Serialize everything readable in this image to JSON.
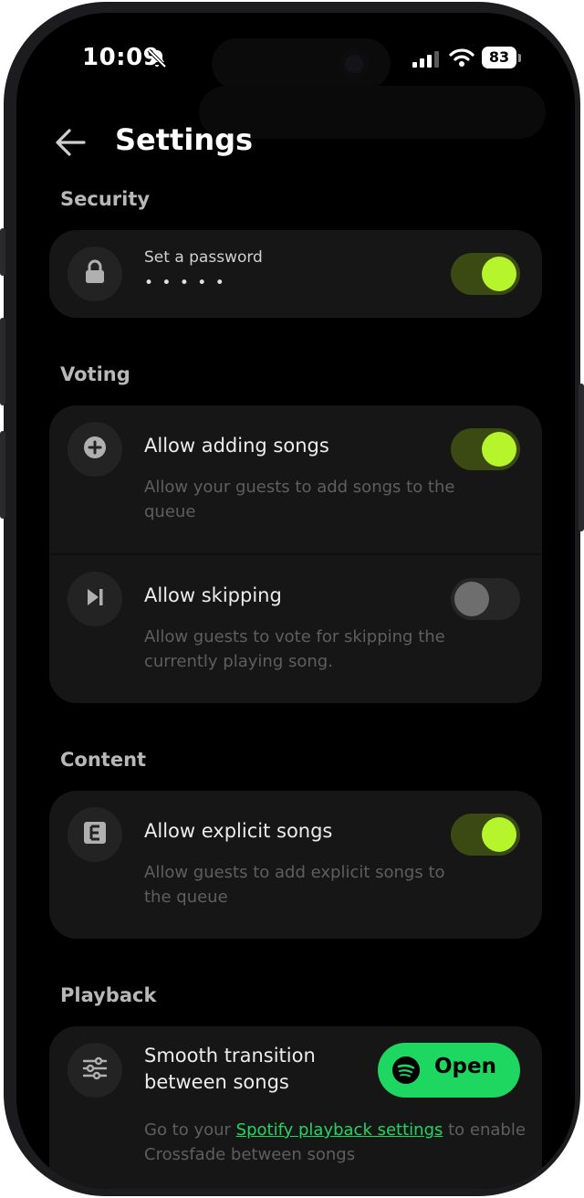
{
  "status_bar": {
    "time": "10:09",
    "battery": "83"
  },
  "header": {
    "title": "Settings"
  },
  "sections": {
    "security": {
      "title": "Security",
      "password_label": "Set a password",
      "password_value": "• • • • •",
      "toggle_on": true
    },
    "voting": {
      "title": "Voting",
      "adding": {
        "title": "Allow adding songs",
        "desc": "Allow your guests to add songs to the queue",
        "toggle_on": true
      },
      "skipping": {
        "title": "Allow skipping",
        "desc": "Allow guests to vote for skipping the currently playing song.",
        "toggle_on": false
      }
    },
    "content": {
      "title": "Content",
      "explicit": {
        "title": "Allow explicit songs",
        "desc": "Allow guests to add explicit songs to the queue",
        "toggle_on": true
      }
    },
    "playback": {
      "title": "Playback",
      "transition_title": "Smooth transition between songs",
      "open_label": "Open",
      "desc_prefix": "Go to your ",
      "desc_link": "Spotify playback settings",
      "desc_suffix": " to enable Crossfade between songs"
    }
  },
  "colors": {
    "accent": "#b6f52b",
    "spotify_green": "#1ed760",
    "card_bg": "#161616"
  },
  "icons": [
    "back-arrow-icon",
    "lock-icon",
    "plus-circle-icon",
    "skip-next-icon",
    "explicit-icon",
    "sliders-icon",
    "spotify-icon",
    "bell-slash-icon",
    "signal-icon",
    "wifi-icon"
  ]
}
